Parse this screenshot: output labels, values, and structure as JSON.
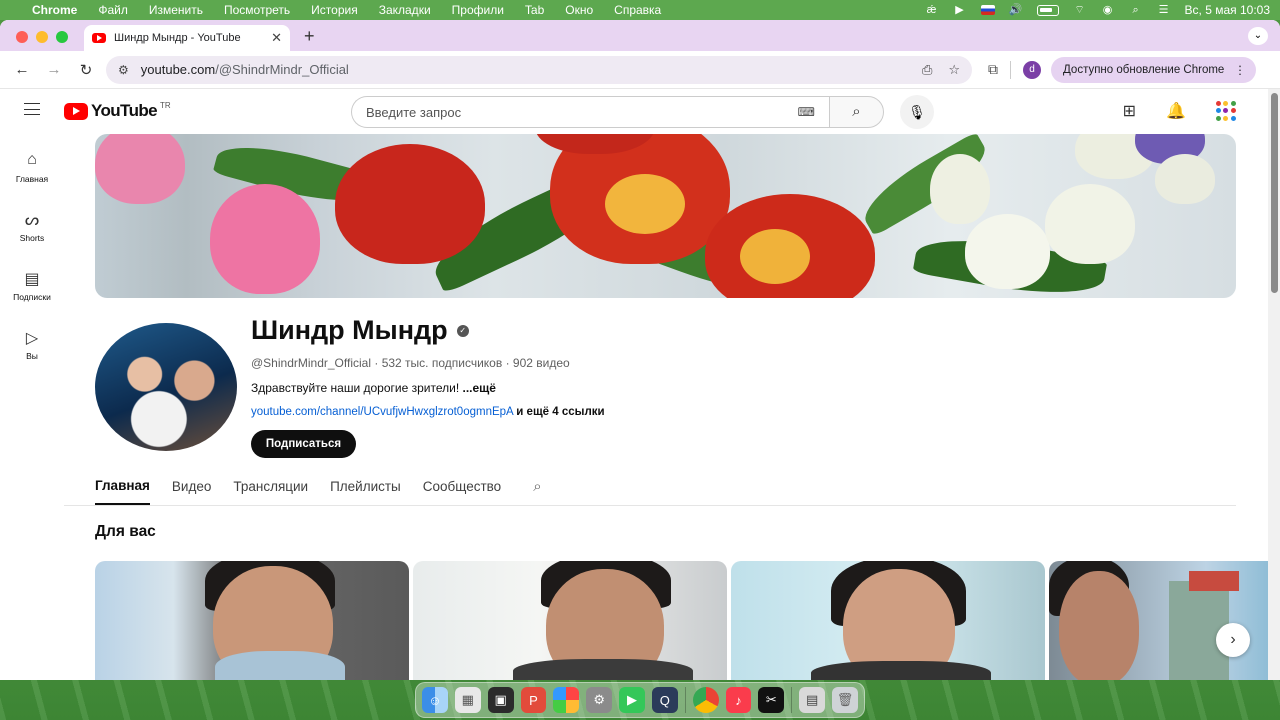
{
  "menubar": {
    "items": [
      "Chrome",
      "Файл",
      "Изменить",
      "Посмотреть",
      "История",
      "Закладки",
      "Профили",
      "Tab",
      "Окно",
      "Справка"
    ],
    "datetime": "Вс, 5 мая  10:03"
  },
  "browser": {
    "tab_title": "Шиндр Мындр - YouTube",
    "url_host": "youtube.com",
    "url_path": "/@ShindrMindr_Official",
    "profile_letter": "d",
    "update_label": "Доступно обновление Chrome"
  },
  "youtube": {
    "logo_text": "YouTube",
    "country_code": "TR",
    "search_placeholder": "Введите запрос",
    "sidebar": [
      {
        "label": "Главная",
        "icon": "home-icon"
      },
      {
        "label": "Shorts",
        "icon": "shorts-icon"
      },
      {
        "label": "Подписки",
        "icon": "subscriptions-icon"
      },
      {
        "label": "Вы",
        "icon": "you-icon"
      }
    ],
    "channel": {
      "name": "Шиндр Мындр",
      "handle": "@ShindrMindr_Official",
      "subscribers": "532 тыс. подписчиков",
      "videos": "902 видео",
      "description": "Здравствуйте наши дорогие зрители!",
      "more": "...ещё",
      "link": "youtube.com/channel/UCvufjwHwxglzrot0ogmnEpA",
      "more_links": "и ещё 4 ссылки",
      "subscribe_label": "Подписаться"
    },
    "tabs": [
      "Главная",
      "Видео",
      "Трансляции",
      "Плейлисты",
      "Сообщество"
    ],
    "active_tab": "Главная",
    "section_title": "Для вас"
  },
  "colors": {
    "accent_red": "#ff0000",
    "link_blue": "#065fd4",
    "tab_strip": "#e8d5f2"
  }
}
